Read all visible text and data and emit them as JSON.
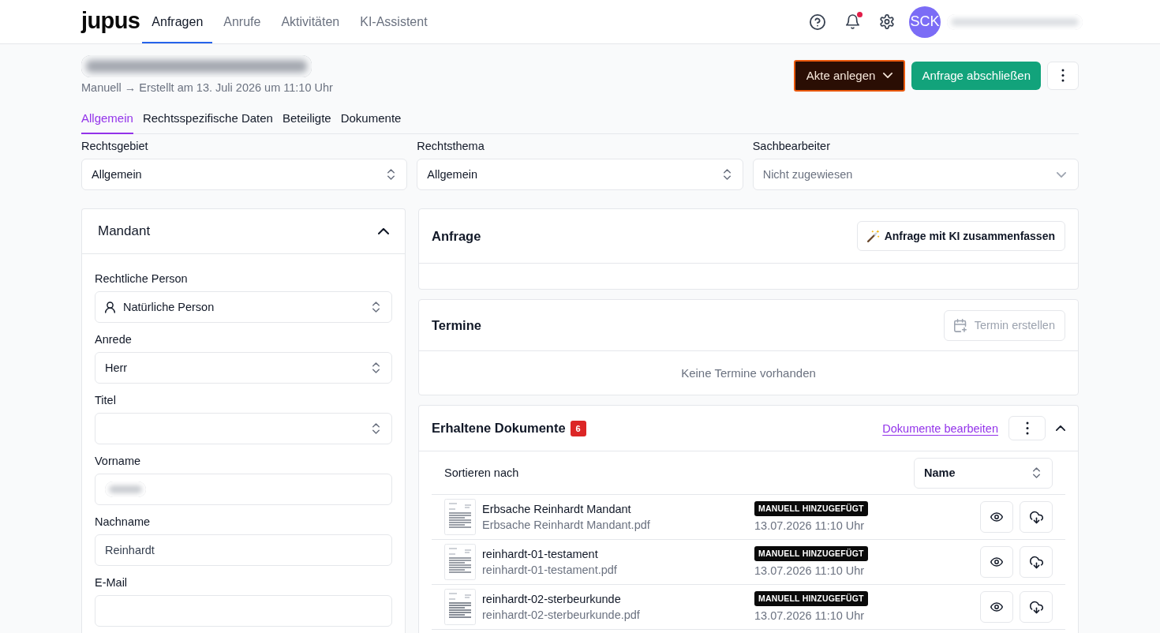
{
  "header": {
    "logo": "jupus",
    "nav": [
      {
        "label": "Anfragen",
        "selected": true
      },
      {
        "label": "Anrufe",
        "selected": false
      },
      {
        "label": "Aktivitäten",
        "selected": false
      },
      {
        "label": "KI-Assistent",
        "selected": false
      }
    ],
    "notifications": true,
    "avatar": "SCK",
    "user_redacted": true
  },
  "page": {
    "title_redacted": true,
    "subtitle": "Manuell → Erstellt am 13. Juli 2026 um 11:10 Uhr",
    "actions": [
      {
        "kind": "dropdown",
        "label": "Akte anlegen",
        "focused": true
      },
      {
        "kind": "primary",
        "label": "Anfrage abschließen",
        "focused": false
      },
      {
        "kind": "more",
        "focused": false
      }
    ]
  },
  "tabs": [
    {
      "label": "Allgemein",
      "selected": true
    },
    {
      "label": "Rechtsspezifische Daten",
      "selected": false
    },
    {
      "label": "Beteiligte",
      "selected": false
    },
    {
      "label": "Dokumente",
      "selected": false
    }
  ],
  "filters": [
    {
      "kind": "select",
      "label": "Rechtsgebiet",
      "value": "Allgemein"
    },
    {
      "kind": "select",
      "label": "Rechtsthema",
      "value": "Allgemein"
    },
    {
      "kind": "dropdown",
      "label": "Sachbearbeiter",
      "placeholder": "Nicht zugewiesen"
    }
  ],
  "mandant": {
    "title": "Mandant",
    "expanded": true,
    "fields": [
      {
        "kind": "persontype",
        "label": "Rechtliche Person",
        "value": "Natürliche Person"
      },
      {
        "kind": "select",
        "label": "Anrede",
        "value": "Herr"
      },
      {
        "kind": "select",
        "label": "Titel"
      },
      {
        "kind": "input",
        "label": "Vorname",
        "redacted": true
      },
      {
        "kind": "input",
        "label": "Nachname",
        "value": "Reinhardt",
        "redacted": false
      },
      {
        "kind": "input",
        "label": "E-Mail",
        "redacted": false
      }
    ]
  },
  "anfrage": {
    "title": "Anfrage",
    "action": {
      "label": "Anfrage mit KI zusammenfassen",
      "disabled": false
    }
  },
  "termine": {
    "title": "Termine",
    "action": {
      "label": "Termin erstellen",
      "disabled": true
    },
    "empty_text": "Keine Termine vorhanden"
  },
  "dokumente": {
    "title": "Erhaltene Dokumente",
    "count": "6",
    "edit_link": "Dokumente bearbeiten",
    "expanded": true,
    "sort_label": "Sortieren nach",
    "sort_value": "Name",
    "items": [
      {
        "name": "Erbsache Reinhardt Mandant",
        "file": "Erbsache Reinhardt Mandant.pdf",
        "tag": "MANUELL HINZUGEFÜGT",
        "date": "13.07.2026 11:10 Uhr"
      },
      {
        "name": "reinhardt-01-testament",
        "file": "reinhardt-01-testament.pdf",
        "tag": "MANUELL HINZUGEFÜGT",
        "date": "13.07.2026 11:10 Uhr"
      },
      {
        "name": "reinhardt-02-sterbeurkunde",
        "file": "reinhardt-02-sterbeurkunde.pdf",
        "tag": "MANUELL HINZUGEFÜGT",
        "date": "13.07.2026 11:10 Uhr"
      }
    ]
  }
}
